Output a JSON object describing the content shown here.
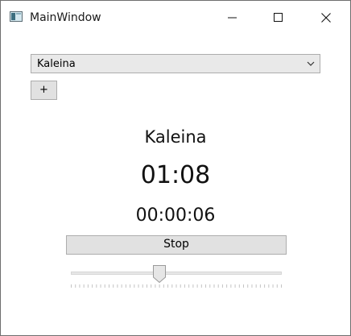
{
  "window": {
    "title": "MainWindow",
    "icons": {
      "app": "app-window-icon",
      "minimize": "minimize-icon",
      "maximize": "maximize-icon",
      "close": "close-icon"
    }
  },
  "selector": {
    "selected_value": "Kaleina",
    "arrow_icon": "chevron-down-icon"
  },
  "add_button": {
    "label": "+"
  },
  "display": {
    "name": "Kaleina",
    "countdown": "01:08",
    "elapsed": "00:00:06"
  },
  "stop_button": {
    "label": "Stop"
  },
  "slider": {
    "value_fraction": 0.42,
    "tick_count": 50
  },
  "colors": {
    "window_border": "#6f6f6f",
    "control_background": "#e1e1e1",
    "control_border": "#adadad"
  }
}
